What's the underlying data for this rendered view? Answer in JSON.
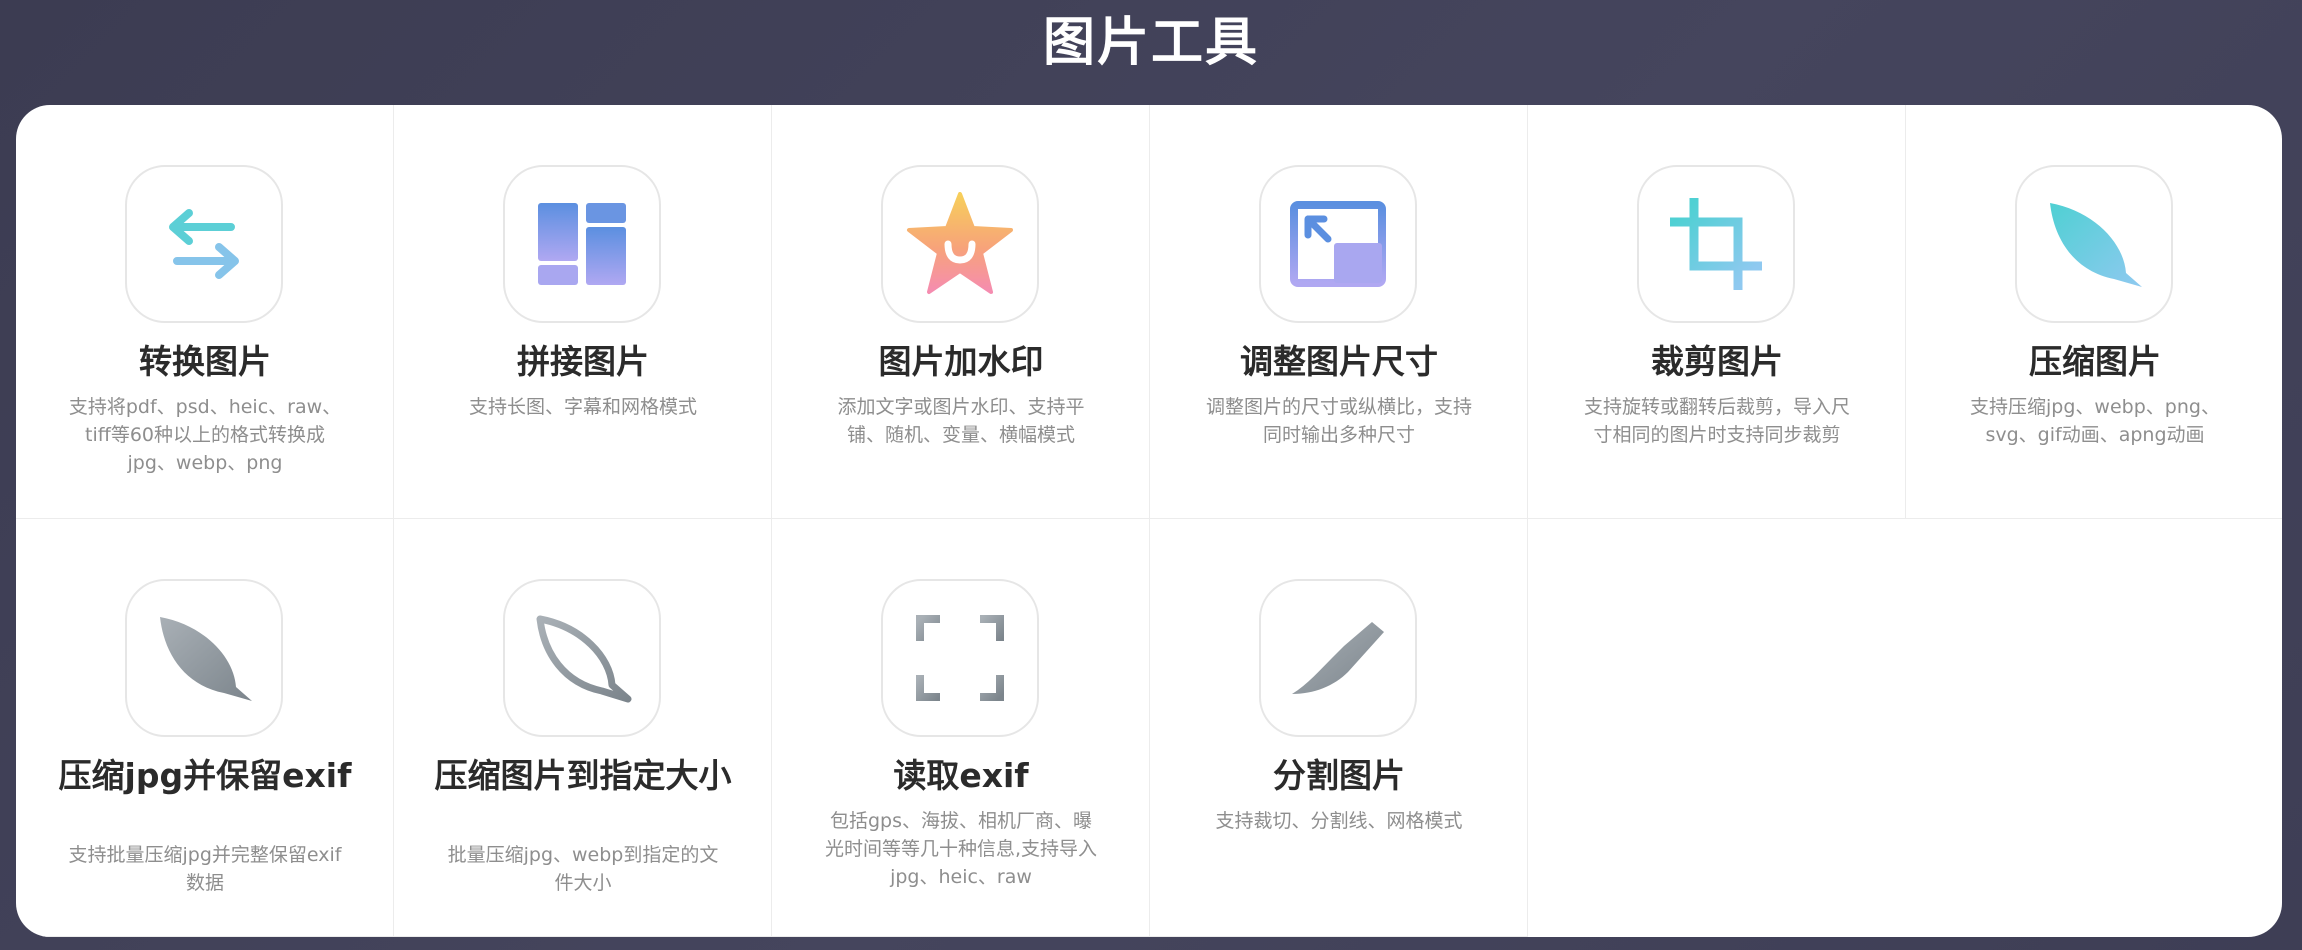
{
  "page": {
    "title": "图片工具"
  },
  "tools": [
    {
      "title": "转换图片",
      "desc": "支持将pdf、psd、heic、raw、tiff等60种以上的格式转换成jpg、webp、png",
      "icon": "convert-arrows-icon"
    },
    {
      "title": "拼接图片",
      "desc": "支持长图、字幕和网格模式",
      "icon": "layout-grid-icon"
    },
    {
      "title": "图片加水印",
      "desc": "添加文字或图片水印、支持平铺、随机、变量、横幅模式",
      "icon": "star-watermark-icon"
    },
    {
      "title": "调整图片尺寸",
      "desc": "调整图片的尺寸或纵横比，支持同时输出多种尺寸",
      "icon": "resize-icon"
    },
    {
      "title": "裁剪图片",
      "desc": "支持旋转或翻转后裁剪，导入尺寸相同的图片时支持同步裁剪",
      "icon": "crop-icon"
    },
    {
      "title": "压缩图片",
      "desc": "支持压缩jpg、webp、png、svg、gif动画、apng动画",
      "icon": "leaf-compress-icon"
    },
    {
      "title": "压缩jpg并保留exif",
      "desc": "支持批量压缩jpg并完整保留exif数据",
      "icon": "leaf-gray-icon"
    },
    {
      "title": "压缩图片到指定大小",
      "desc": "批量压缩jpg、webp到指定的文件大小",
      "icon": "leaf-outline-icon"
    },
    {
      "title": "读取exif",
      "desc": "包括gps、海拔、相机厂商、曝光时间等等几十种信息,支持导入jpg、heic、raw",
      "icon": "scan-icon"
    },
    {
      "title": "分割图片",
      "desc": "支持裁切、分割线、网格模式",
      "icon": "knife-icon"
    }
  ],
  "colors": {
    "background": "#3f3f56",
    "accent_cyan": "#5ccfd6",
    "accent_purple": "#a9a7f0",
    "gray_icon": "#8b9298"
  }
}
